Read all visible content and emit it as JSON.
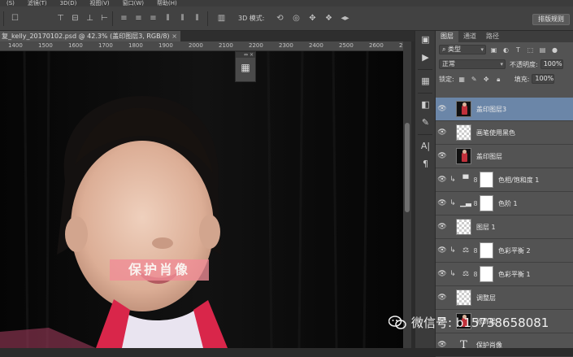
{
  "menubar": {
    "items": [
      "(S)",
      "滤镜(T)",
      "3D(D)",
      "视图(V)",
      "窗口(W)",
      "帮助(H)"
    ]
  },
  "options_bar": {
    "mode_label": "3D 模式:",
    "layout_button": "排版规则"
  },
  "document": {
    "tab_title": "复_kelly_20170102.psd @ 42.3% (盖印图层3, RGB/8)",
    "close_symbol": "×",
    "ruler_ticks": [
      "1400",
      "1500",
      "1600",
      "1700",
      "1800",
      "1900",
      "2000",
      "2100",
      "2200",
      "2300",
      "2400",
      "2500",
      "2600",
      "2700",
      "2800"
    ]
  },
  "canvas": {
    "privacy_label": "保护肖像",
    "watermark_text": "微信号: b15738658081"
  },
  "layers_panel": {
    "tabs": [
      "图层",
      "通道",
      "路径"
    ],
    "filter_label": "类型",
    "blend_mode": "正常",
    "opacity_label": "不透明度:",
    "opacity_value": "100%",
    "lock_label": "锁定:",
    "fill_label": "填充:",
    "fill_value": "100%",
    "layers": [
      {
        "name": "盖印图层3",
        "kind": "photo",
        "selected": true
      },
      {
        "name": "画笔使用黑色",
        "kind": "transparent",
        "selected": false
      },
      {
        "name": "盖印图层",
        "kind": "photo",
        "selected": false
      },
      {
        "name": "色相/饱和度 1",
        "kind": "adjustment",
        "icon": "hue-sat",
        "selected": false
      },
      {
        "name": "色阶 1",
        "kind": "adjustment",
        "icon": "levels",
        "selected": false
      },
      {
        "name": "图层 1",
        "kind": "transparent",
        "selected": false
      },
      {
        "name": "色彩平衡 2",
        "kind": "adjustment",
        "icon": "balance",
        "selected": false
      },
      {
        "name": "色彩平衡 1",
        "kind": "adjustment",
        "icon": "balance",
        "selected": false
      },
      {
        "name": "调整层",
        "kind": "transparent",
        "selected": false
      },
      {
        "name": "修饰层",
        "kind": "photo",
        "selected": false
      },
      {
        "name": "保护肖像",
        "kind": "text",
        "selected": false
      }
    ]
  },
  "colors": {
    "selected_layer": "#6b86a8",
    "privacy_box": "#f08c96",
    "canvas_bg": "#0a0a0a"
  }
}
